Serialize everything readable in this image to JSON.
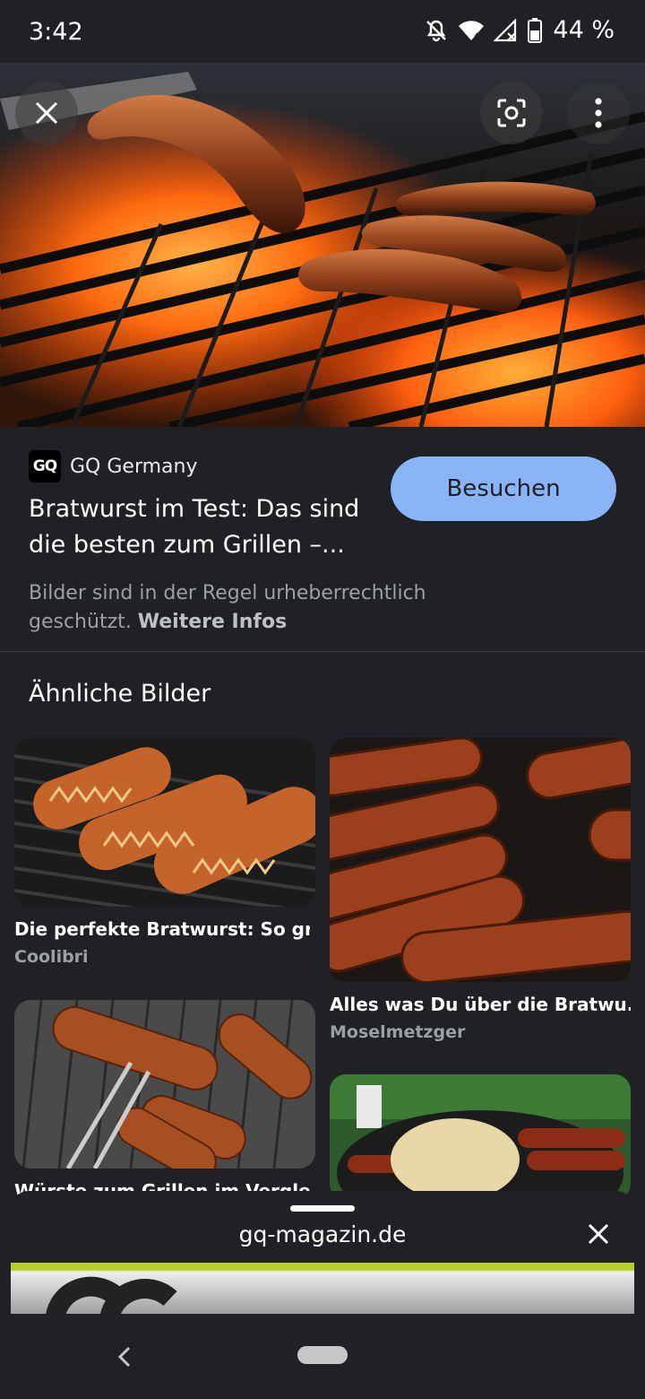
{
  "status": {
    "time": "3:42",
    "battery": "44 %"
  },
  "source": {
    "logo_text": "GQ",
    "name": "GQ Germany"
  },
  "result": {
    "title": "Bratwurst im Test: Das sind die besten zum Grillen –...",
    "visit_label": "Besuchen"
  },
  "copyright": {
    "text": "Bilder sind in der Regel urheberrechtlich geschützt.",
    "link": "Weitere Infos"
  },
  "similar": {
    "heading": "Ähnliche Bilder",
    "items": [
      {
        "title": "Die perfekte Bratwurst: So gri...",
        "source": "Coolibri"
      },
      {
        "title": "Alles was Du über die Bratwu...",
        "source": "Moselmetzger"
      },
      {
        "title": "Würste zum Grillen im Vergleich",
        "source": ""
      },
      {
        "title": "",
        "source": ""
      }
    ]
  },
  "sheet": {
    "url": "gq-magazin.de"
  },
  "icons": {
    "close": "close-icon",
    "lens": "lens-icon",
    "more": "more-vert-icon",
    "back": "back-icon"
  },
  "colors": {
    "accent": "#8ab4f8",
    "background": "#202124"
  }
}
